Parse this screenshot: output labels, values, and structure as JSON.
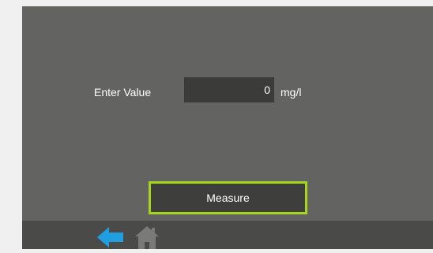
{
  "form": {
    "label": "Enter Value",
    "value": "0",
    "unit": "mg/l"
  },
  "actions": {
    "measure_label": "Measure"
  },
  "navigation": {
    "back_icon": "back-arrow-icon",
    "home_icon": "home-icon"
  },
  "colors": {
    "screen_background": "#636461",
    "field_background": "#3b3b3a",
    "button_border": "#a6d61c",
    "bottom_bar": "#4a4b49",
    "back_icon": "#1f9ee0",
    "home_icon": "#7a7b79"
  }
}
